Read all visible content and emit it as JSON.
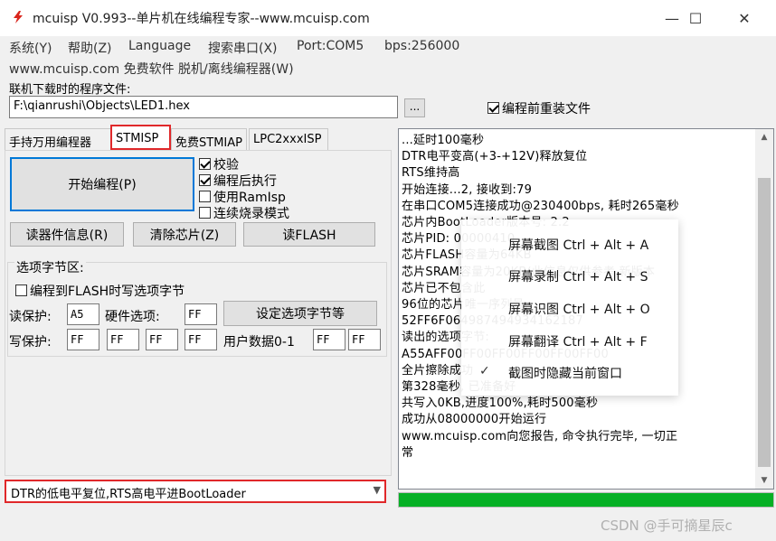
{
  "window": {
    "title": "mcuisp V0.993--单片机在线编程专家--www.mcuisp.com",
    "controls": {
      "minimize": "—",
      "maximize": "☐",
      "close": "✕"
    },
    "icon": "chip-icon"
  },
  "menu": {
    "items": [
      "系统(Y)",
      "帮助(Z)",
      "Language",
      "搜索串口(X)",
      "Port:COM5",
      "bps:256000"
    ],
    "second_row": "www.mcuisp.com 免费软件 脱机/离线编程器(W)"
  },
  "file": {
    "label": "联机下载时的程序文件:",
    "path": "F:\\qianrushi\\Objects\\LED1.hex",
    "browse_label": "...",
    "reload_label": "编程前重装文件",
    "reload_checked": true
  },
  "tabs": [
    {
      "label": "手持万用编程器",
      "active": false
    },
    {
      "label": "STMISP",
      "active": true
    },
    {
      "label": "免费STMIAP",
      "active": false
    },
    {
      "label": "LPC2xxxISP",
      "active": false
    }
  ],
  "actions": {
    "start": "开始编程(P)",
    "read_info": "读器件信息(R)",
    "clear_chip": "清除芯片(Z)",
    "read_flash": "读FLASH"
  },
  "options": [
    {
      "label": "校验",
      "checked": true
    },
    {
      "label": "编程后执行",
      "checked": true
    },
    {
      "label": "使用RamIsp",
      "checked": false
    },
    {
      "label": "连续烧录模式",
      "checked": false
    }
  ],
  "option_bytes": {
    "group_label": "选项字节区:",
    "write_to_flash": "编程到FLASH时写选项字节",
    "read_protect_label": "读保护:",
    "read_protect_value": "A5",
    "hw_option_label": "硬件选项:",
    "hw_option_value": "FF",
    "set_button": "设定选项字节等",
    "write_protect_label": "写保护:",
    "write_protect_values": [
      "FF",
      "FF",
      "FF",
      "FF"
    ],
    "user_data_label": "用户数据0-1",
    "user_data_values": [
      "FF",
      "FF"
    ]
  },
  "reset_mode": {
    "selected": "DTR的低电平复位,RTS高电平进BootLoader"
  },
  "log": [
    "...延时100毫秒",
    "DTR电平变高(+3-+12V)释放复位",
    "RTS维持高",
    "开始连接...2, 接收到:79",
    "在串口COM5连接成功@230400bps, 耗时265毫秒",
    "芯片内BootLoader版本号: 2.2",
    "芯片PID: 00000410",
    "芯片FLASH容量为64KB",
    "芯片SRAM容量为20KB(此信息仅供参考,新版本",
    "芯片已不包含此",
    "96位的芯片唯一序列号:",
    "52FF6F064987494934162187",
    "读出的选项字节:",
    "A55AFF00FF00FF00FF00FF00FF00",
    "全片擦除成功",
    "第328毫秒, 已准备好",
    "共写入0KB,进度100%,耗时500毫秒",
    "成功从08000000开始运行",
    "www.mcuisp.com向您报告, 命令执行完毕, 一切正",
    "常"
  ],
  "progress": {
    "value": 1.0,
    "color": "#06b025"
  },
  "context_menu": {
    "items": [
      {
        "label": "屏幕截图 Ctrl + Alt + A",
        "checked": false
      },
      {
        "label": "屏幕录制 Ctrl + Alt + S",
        "checked": false
      },
      {
        "label": "屏幕识图 Ctrl + Alt + O",
        "checked": false
      },
      {
        "label": "屏幕翻译 Ctrl + Alt + F",
        "checked": false
      },
      {
        "label": "截图时隐藏当前窗口",
        "checked": true
      }
    ]
  },
  "watermark": "CSDN @手可摘星辰c",
  "colors": {
    "highlight": "#e0282a",
    "accent": "#0078d7",
    "progress": "#06b025"
  }
}
